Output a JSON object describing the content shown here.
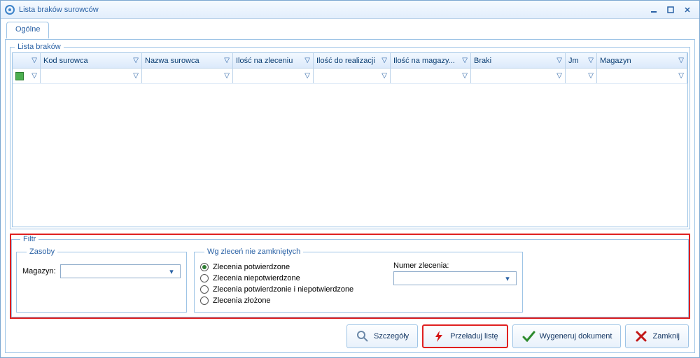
{
  "window": {
    "title": "Lista braków surowców"
  },
  "tabs": {
    "main": "Ogólne"
  },
  "grid": {
    "legend": "Lista braków",
    "columns": [
      "",
      "Kod surowca",
      "Nazwa surowca",
      "Ilość na zleceniu",
      "Ilość do realizacji",
      "Ilość na magazy...",
      "Braki",
      "Jm",
      "Magazyn"
    ]
  },
  "filter": {
    "legend": "Filtr",
    "zasoby": {
      "legend": "Zasoby",
      "magazyn_label": "Magazyn:"
    },
    "wg": {
      "legend": "Wg zleceń nie zamkniętych",
      "options": [
        "Zlecenia potwierdzone",
        "Zlecenia niepotwierdzone",
        "Zlecenia potwierdzonie i niepotwierdzone",
        "Zlecenia złożone"
      ],
      "numer_label": "Numer zlecenia:"
    }
  },
  "buttons": {
    "details": "Szczegóły",
    "reload": "Przeładuj listę",
    "generate": "Wygeneruj dokument",
    "close": "Zamknij"
  }
}
